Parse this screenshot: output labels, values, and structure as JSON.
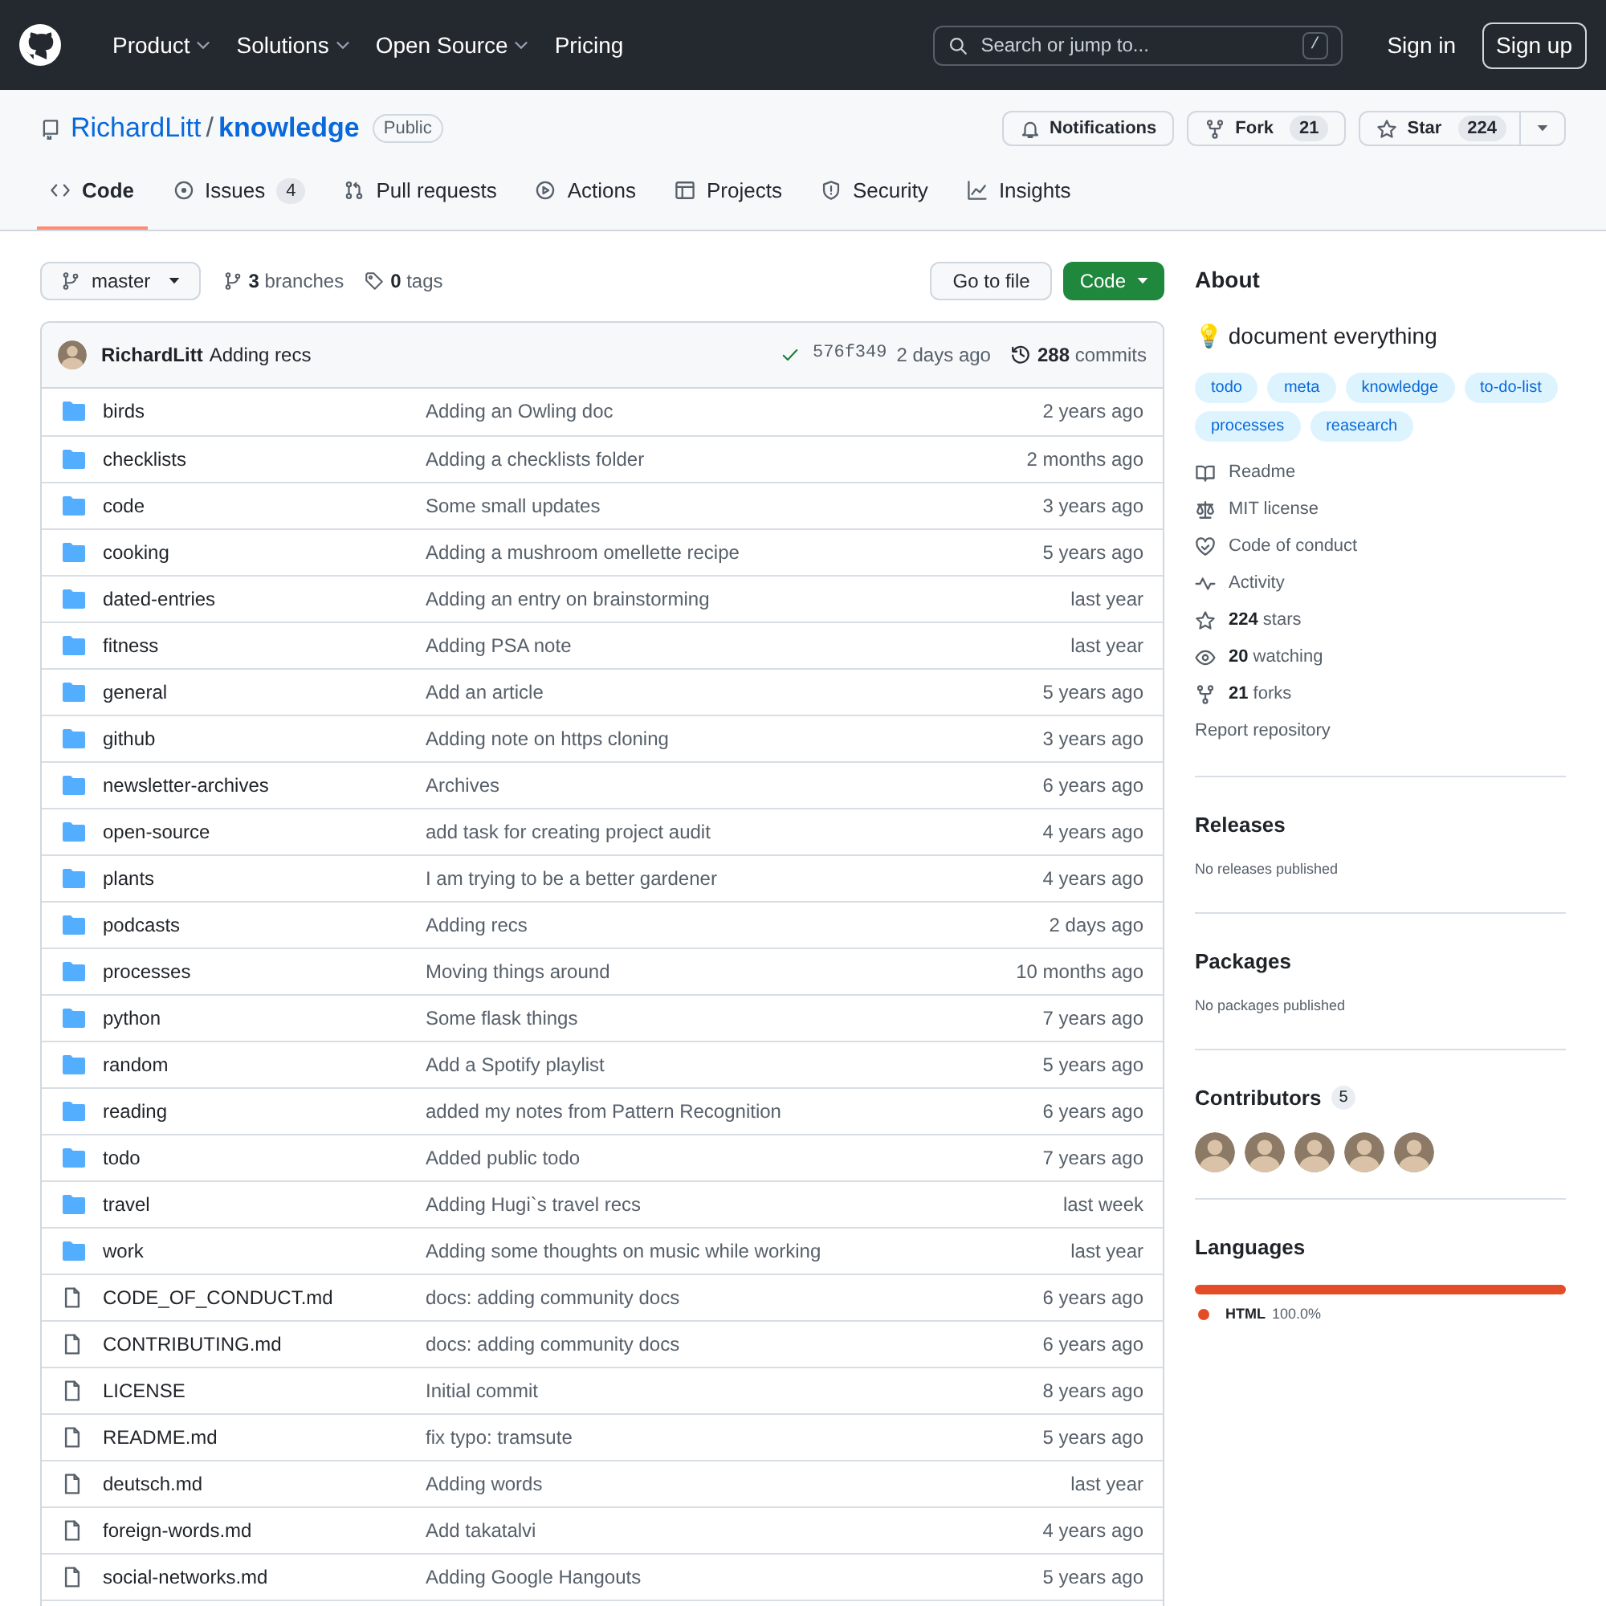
{
  "header": {
    "nav": [
      {
        "label": "Product",
        "dropdown": true
      },
      {
        "label": "Solutions",
        "dropdown": true
      },
      {
        "label": "Open Source",
        "dropdown": true
      },
      {
        "label": "Pricing",
        "dropdown": false
      }
    ],
    "search": {
      "placeholder": "Search or jump to...",
      "shortcut": "/"
    },
    "sign_in": "Sign in",
    "sign_up": "Sign up"
  },
  "repo": {
    "owner": "RichardLitt",
    "separator": "/",
    "name": "knowledge",
    "visibility": "Public",
    "actions": [
      {
        "kind": "bell",
        "label": "Notifications"
      },
      {
        "kind": "fork",
        "label": "Fork",
        "count": "21"
      },
      {
        "kind": "star",
        "label": "Star",
        "count": "224"
      }
    ]
  },
  "tabs": [
    {
      "kind": "code",
      "label": "Code",
      "selected": true
    },
    {
      "kind": "issue",
      "label": "Issues",
      "count": "4",
      "selected": false
    },
    {
      "kind": "pr",
      "label": "Pull requests",
      "selected": false
    },
    {
      "kind": "play",
      "label": "Actions",
      "selected": false
    },
    {
      "kind": "table",
      "label": "Projects",
      "selected": false
    },
    {
      "kind": "shield",
      "label": "Security",
      "selected": false
    },
    {
      "kind": "graph",
      "label": "Insights",
      "selected": false
    }
  ],
  "toolbar": {
    "branch": "master",
    "branches": "**3** branches",
    "tags": "**0** tags",
    "go_to_file": "Go to file",
    "code_button": "Code"
  },
  "commit": {
    "author": "RichardLitt",
    "message": "Adding recs",
    "sha": "576f349",
    "time": "2 days ago",
    "commits": "**288** commits"
  },
  "files": [
    {
      "kind": "dir",
      "name": "birds",
      "message": "Adding an Owling doc",
      "age": "2 years ago"
    },
    {
      "kind": "dir",
      "name": "checklists",
      "message": "Adding a checklists folder",
      "age": "2 months ago"
    },
    {
      "kind": "dir",
      "name": "code",
      "message": "Some small updates",
      "age": "3 years ago"
    },
    {
      "kind": "dir",
      "name": "cooking",
      "message": "Adding a mushroom omellette recipe",
      "age": "5 years ago"
    },
    {
      "kind": "dir",
      "name": "dated-entries",
      "message": "Adding an entry on brainstorming",
      "age": "last year"
    },
    {
      "kind": "dir",
      "name": "fitness",
      "message": "Adding PSA note",
      "age": "last year"
    },
    {
      "kind": "dir",
      "name": "general",
      "message": "Add an article",
      "age": "5 years ago"
    },
    {
      "kind": "dir",
      "name": "github",
      "message": "Adding note on https cloning",
      "age": "3 years ago"
    },
    {
      "kind": "dir",
      "name": "newsletter-archives",
      "message": "Archives",
      "age": "6 years ago"
    },
    {
      "kind": "dir",
      "name": "open-source",
      "message": "add task for creating project audit",
      "age": "4 years ago"
    },
    {
      "kind": "dir",
      "name": "plants",
      "message": "I am trying to be a better gardener",
      "age": "4 years ago"
    },
    {
      "kind": "dir",
      "name": "podcasts",
      "message": "Adding recs",
      "age": "2 days ago"
    },
    {
      "kind": "dir",
      "name": "processes",
      "message": "Moving things around",
      "age": "10 months ago"
    },
    {
      "kind": "dir",
      "name": "python",
      "message": "Some flask things",
      "age": "7 years ago"
    },
    {
      "kind": "dir",
      "name": "random",
      "message": "Add a Spotify playlist",
      "age": "5 years ago"
    },
    {
      "kind": "dir",
      "name": "reading",
      "message": "added my notes from Pattern Recognition",
      "age": "6 years ago"
    },
    {
      "kind": "dir",
      "name": "todo",
      "message": "Added public todo",
      "age": "7 years ago"
    },
    {
      "kind": "dir",
      "name": "travel",
      "message": "Adding Hugi`s travel recs",
      "age": "last week"
    },
    {
      "kind": "dir",
      "name": "work",
      "message": "Adding some thoughts on music while working",
      "age": "last year"
    },
    {
      "kind": "file",
      "name": "CODE_OF_CONDUCT.md",
      "message": "docs: adding community docs",
      "age": "6 years ago"
    },
    {
      "kind": "file",
      "name": "CONTRIBUTING.md",
      "message": "docs: adding community docs",
      "age": "6 years ago"
    },
    {
      "kind": "file",
      "name": "LICENSE",
      "message": "Initial commit",
      "age": "8 years ago"
    },
    {
      "kind": "file",
      "name": "README.md",
      "message": "fix typo: tramsute",
      "age": "5 years ago"
    },
    {
      "kind": "file",
      "name": "deutsch.md",
      "message": "Adding words",
      "age": "last year"
    },
    {
      "kind": "file",
      "name": "foreign-words.md",
      "message": "Add takatalvi",
      "age": "4 years ago"
    },
    {
      "kind": "file",
      "name": "social-networks.md",
      "message": "Adding Google Hangouts",
      "age": "5 years ago"
    }
  ],
  "about": {
    "title": "About",
    "description": "💡 document everything",
    "topics": [
      "todo",
      "meta",
      "knowledge",
      "to-do-list",
      "processes",
      "reasearch"
    ],
    "links": [
      {
        "kind": "book",
        "text": "Readme"
      },
      {
        "kind": "scale",
        "text": "MIT license"
      },
      {
        "kind": "heart",
        "text": "Code of conduct"
      },
      {
        "kind": "pulse",
        "text": "Activity"
      },
      {
        "kind": "star",
        "text": "**224** stars"
      },
      {
        "kind": "eye",
        "text": "**20** watching"
      },
      {
        "kind": "fork",
        "text": "**21** forks"
      }
    ],
    "report": "Report repository"
  },
  "releases": {
    "title": "Releases",
    "note": "No releases published"
  },
  "packages": {
    "title": "Packages",
    "note": "No packages published"
  },
  "contributors": {
    "title": "Contributors",
    "count": "5"
  },
  "languages": {
    "title": "Languages",
    "items": [
      {
        "name": "HTML",
        "percent": "100.0%",
        "level": 1.0,
        "color": "#e34c26"
      }
    ]
  }
}
